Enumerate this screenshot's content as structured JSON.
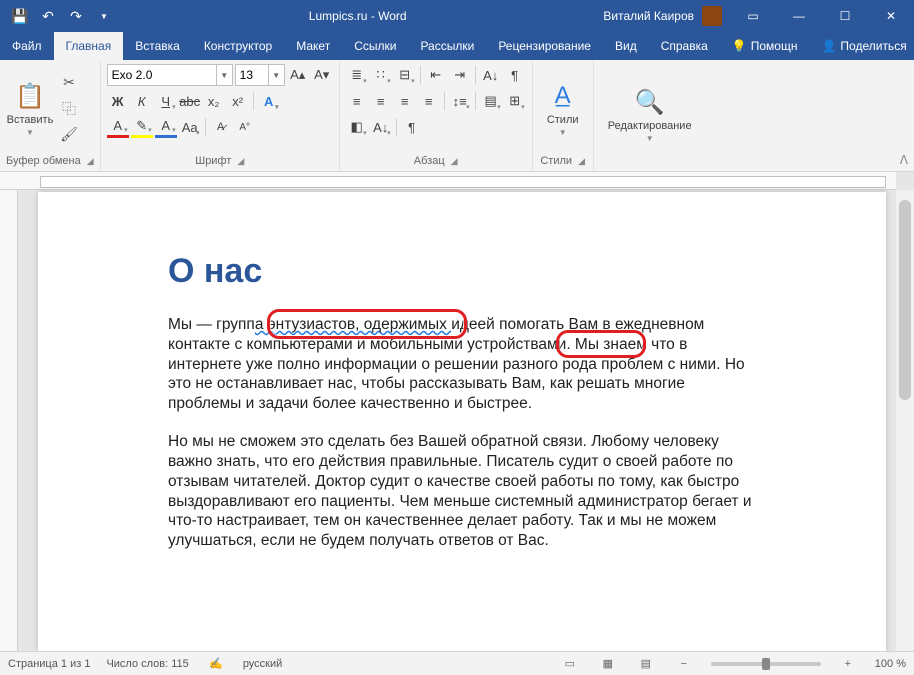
{
  "titlebar": {
    "title": "Lumpics.ru  -  Word",
    "user": "Виталий Каиров"
  },
  "tabs": {
    "items": [
      "Файл",
      "Главная",
      "Вставка",
      "Конструктор",
      "Макет",
      "Ссылки",
      "Рассылки",
      "Рецензирование",
      "Вид",
      "Справка"
    ],
    "active_index": 1,
    "help": "Помощн",
    "share": "Поделиться"
  },
  "ribbon": {
    "clipboard": {
      "paste": "Вставить",
      "label": "Буфер обмена"
    },
    "font": {
      "name": "Exo 2.0",
      "size": "13",
      "label": "Шрифт"
    },
    "paragraph": {
      "label": "Абзац"
    },
    "styles": {
      "btn": "Стили",
      "label": "Стили"
    },
    "editing": {
      "btn": "Редактирование"
    }
  },
  "document": {
    "title": "О нас",
    "p1_a": "Мы — групп",
    "p1_wavy": "а энтузиастов,  одержимых ",
    "p1_b": "идеей помогать Вам в ежедневном контакте с компьютерами и мобильными устройствами. Мы знаем что в интернете уже полно информации о решении разного рода проблем с ними. Но это не останавливает нас, чтобы рассказывать Вам, как решать многие проблемы и задачи более качественно и быстрее.",
    "p2": "Но мы не сможем это сделать без Вашей обратной связи. Любому человеку важно знать, что его действия правильные. Писатель судит о своей работе по отзывам читателей. Доктор судит о качестве своей работы по тому, как быстро выздоравливают его пациенты. Чем меньше системный администратор бегает и что-то настраивает, тем он качественнее делает работу. Так и мы не можем улучшаться, если не будем получать ответов от Вас."
  },
  "statusbar": {
    "page": "Страница 1 из 1",
    "words": "Число слов: 115",
    "lang": "русский",
    "zoom": "100 %"
  }
}
